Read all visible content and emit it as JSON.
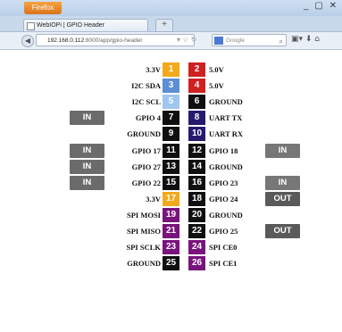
{
  "browser": {
    "menu_label": "Firefox",
    "window_controls": "_ ▢ ✕",
    "tab_title": "WebIOPi | GPIO Header",
    "new_tab": "+",
    "url_host": "192.168.0.112",
    "url_path": ":8000/app/gpio-header",
    "search_placeholder": "Google"
  },
  "colors": {
    "power33": "#f2a91c",
    "power5": "#d02020",
    "i2c": "#5b8fd6",
    "i2c_light": "#9ec6ee",
    "ground": "#101010",
    "uart": "#241b70",
    "gpio": "#101010",
    "spi": "#7a147d"
  },
  "header_rows": [
    {
      "left_label": "3.3V",
      "left_pin": "1",
      "left_type": "power33",
      "right_pin": "2",
      "right_type": "power5",
      "right_label": "5.0V",
      "left_btn": "",
      "right_btn": ""
    },
    {
      "left_label": "I2C SDA",
      "left_pin": "3",
      "left_type": "i2c",
      "right_pin": "4",
      "right_type": "power5",
      "right_label": "5.0V",
      "left_btn": "",
      "right_btn": ""
    },
    {
      "left_label": "I2C SCL",
      "left_pin": "5",
      "left_type": "i2c_light",
      "right_pin": "6",
      "right_type": "ground",
      "right_label": "GROUND",
      "left_btn": "",
      "right_btn": ""
    },
    {
      "left_label": "GPIO 4",
      "left_pin": "7",
      "left_type": "gpio",
      "right_pin": "8",
      "right_type": "uart",
      "right_label": "UART TX",
      "left_btn": "IN",
      "right_btn": ""
    },
    {
      "left_label": "GROUND",
      "left_pin": "9",
      "left_type": "ground",
      "right_pin": "10",
      "right_type": "uart",
      "right_label": "UART RX",
      "left_btn": "",
      "right_btn": ""
    },
    {
      "left_label": "GPIO 17",
      "left_pin": "11",
      "left_type": "gpio",
      "right_pin": "12",
      "right_type": "gpio",
      "right_label": "GPIO 18",
      "left_btn": "IN",
      "right_btn": "IN"
    },
    {
      "left_label": "GPIO 27",
      "left_pin": "13",
      "left_type": "gpio",
      "right_pin": "14",
      "right_type": "ground",
      "right_label": "GROUND",
      "left_btn": "IN",
      "right_btn": ""
    },
    {
      "left_label": "GPIO 22",
      "left_pin": "15",
      "left_type": "gpio",
      "right_pin": "16",
      "right_type": "gpio",
      "right_label": "GPIO 23",
      "left_btn": "IN",
      "right_btn": "IN"
    },
    {
      "left_label": "3.3V",
      "left_pin": "17",
      "left_type": "power33",
      "right_pin": "18",
      "right_type": "gpio",
      "right_label": "GPIO 24",
      "left_btn": "",
      "right_btn": "OUT"
    },
    {
      "left_label": "SPI MOSI",
      "left_pin": "19",
      "left_type": "spi",
      "right_pin": "20",
      "right_type": "ground",
      "right_label": "GROUND",
      "left_btn": "",
      "right_btn": ""
    },
    {
      "left_label": "SPI MISO",
      "left_pin": "21",
      "left_type": "spi",
      "right_pin": "22",
      "right_type": "gpio",
      "right_label": "GPIO 25",
      "left_btn": "",
      "right_btn": "OUT"
    },
    {
      "left_label": "SPI SCLK",
      "left_pin": "23",
      "left_type": "spi",
      "right_pin": "24",
      "right_type": "spi",
      "right_label": "SPI CE0",
      "left_btn": "",
      "right_btn": ""
    },
    {
      "left_label": "GROUND",
      "left_pin": "25",
      "left_type": "ground",
      "right_pin": "26",
      "right_type": "spi",
      "right_label": "SPI CE1",
      "left_btn": "",
      "right_btn": ""
    }
  ]
}
